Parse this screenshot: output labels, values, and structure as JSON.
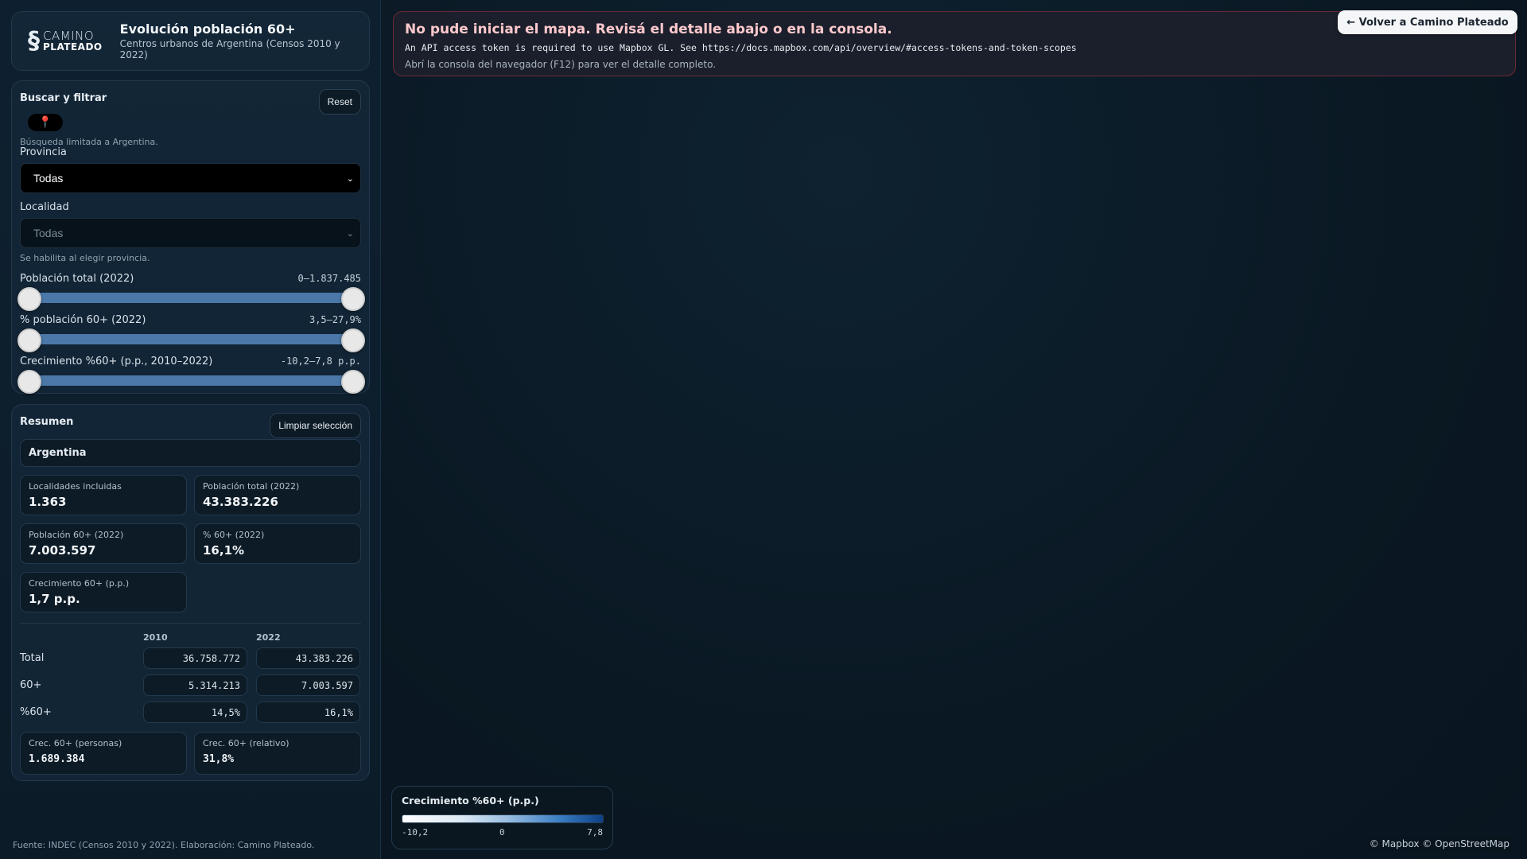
{
  "header": {
    "logo_line1": "CAMINO",
    "logo_line2": "PLATEADO",
    "title": "Evolución población 60+",
    "subtitle": "Centros urbanos de Argentina (Censos 2010 y 2022)"
  },
  "filters": {
    "title": "Buscar y filtrar",
    "reset_label": "Reset",
    "search_note": "Búsqueda limitada a Argentina.",
    "provincia_label": "Provincia",
    "provincia_value": "Todas",
    "localidad_label": "Localidad",
    "localidad_value": "Todas",
    "localidad_note": "Se habilita al elegir provincia.",
    "ranges": [
      {
        "label": "Población total (2022)",
        "value": "0–1.837.485",
        "low": 0,
        "high": 1
      },
      {
        "label": "% población 60+ (2022)",
        "value": "3,5–27,9%",
        "low": 0,
        "high": 1
      },
      {
        "label": "Crecimiento %60+ (p.p., 2010–2022)",
        "value": "-10,2–7,8 p.p.",
        "low": 0,
        "high": 1
      }
    ]
  },
  "summary": {
    "title": "Resumen",
    "clear_label": "Limpiar selección",
    "region": "Argentina",
    "stats": [
      {
        "label": "Localidades incluidas",
        "value": "1.363"
      },
      {
        "label": "Población total (2022)",
        "value": "43.383.226"
      },
      {
        "label": "Población 60+ (2022)",
        "value": "7.003.597"
      },
      {
        "label": "% 60+ (2022)",
        "value": "16,1%"
      },
      {
        "label": "Crecimiento 60+ (p.p.)",
        "value": "1,7 p.p."
      }
    ],
    "table": {
      "col_2010": "2010",
      "col_2022": "2022",
      "rows": [
        {
          "label": "Total",
          "v2010": "36.758.772",
          "v2022": "43.383.226"
        },
        {
          "label": "60+",
          "v2010": "5.314.213",
          "v2022": "7.003.597"
        },
        {
          "label": "%60+",
          "v2010": "14,5%",
          "v2022": "16,1%"
        }
      ]
    },
    "growth": [
      {
        "label": "Crec. 60+ (personas)",
        "value": "1.689.384"
      },
      {
        "label": "Crec. 60+ (relativo)",
        "value": "31,8%"
      }
    ]
  },
  "footer_source": "Fuente: INDEC (Censos 2010 y 2022). Elaboración: Camino Plateado.",
  "error": {
    "title": "No pude iniciar el mapa. Revisá el detalle abajo o en la consola.",
    "message": "An API access token is required to use Mapbox GL. See https://docs.mapbox.com/api/overview/#access-tokens-and-token-scopes",
    "hint": "Abrí la consola del navegador (F12) para ver el detalle completo."
  },
  "back_button": "← Volver a Camino Plateado",
  "legend": {
    "title": "Crecimiento %60+ (p.p.)",
    "min": "-10,2",
    "mid": "0",
    "max": "7,8"
  },
  "attribution": "© Mapbox © OpenStreetMap"
}
